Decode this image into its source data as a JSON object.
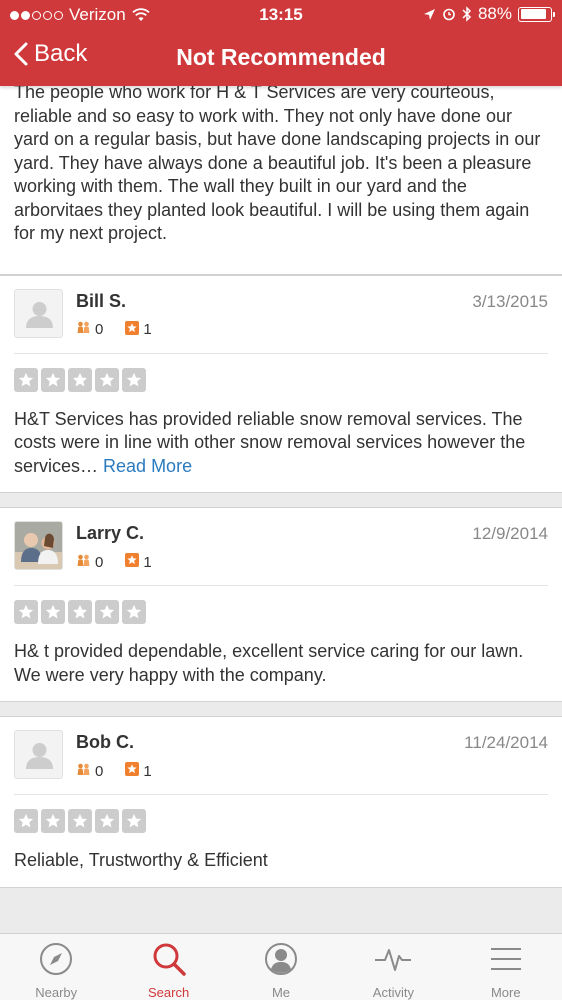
{
  "status_bar": {
    "carrier": "Verizon",
    "time": "13:15",
    "battery": "88%",
    "battery_level": 0.88
  },
  "nav": {
    "back_label": "Back",
    "title": "Not Recommended"
  },
  "first_review_text": "The people who work for H & T Services are very courteous, reliable and so easy to work with. They not only have done our yard on a regular basis, but have done landscaping projects in our yard. They have always done a beautiful job. It's been a pleasure working with them. The wall they built in our yard and the arborvitaes they planted look beautiful. I will be using them again for my next project.",
  "reviews": [
    {
      "name": "Bill S.",
      "date": "3/13/2015",
      "friends": "0",
      "review_count": "1",
      "rating": 0,
      "text": "H&T Services has provided reliable snow removal services.  The costs were in line with other snow removal services however the services…",
      "read_more": "Read More",
      "avatar": "default-avatar"
    },
    {
      "name": "Larry C.",
      "date": "12/9/2014",
      "friends": "0",
      "review_count": "1",
      "rating": 0,
      "text": "H& t provided dependable, excellent service caring for our lawn.  We were very happy with the company.",
      "avatar": "photo-avatar"
    },
    {
      "name": "Bob C.",
      "date": "11/24/2014",
      "friends": "0",
      "review_count": "1",
      "rating": 0,
      "text": "Reliable, Trustworthy & Efficient",
      "avatar": "default-avatar"
    }
  ],
  "tabs": [
    {
      "label": "Nearby",
      "icon": "compass-icon",
      "active": false
    },
    {
      "label": "Search",
      "icon": "search-icon",
      "active": true
    },
    {
      "label": "Me",
      "icon": "profile-icon",
      "active": false
    },
    {
      "label": "Activity",
      "icon": "activity-icon",
      "active": false
    },
    {
      "label": "More",
      "icon": "menu-icon",
      "active": false
    }
  ],
  "colors": {
    "brand_red": "#d0393b",
    "link_blue": "#2a7bbf",
    "star_empty": "#cccccc"
  }
}
